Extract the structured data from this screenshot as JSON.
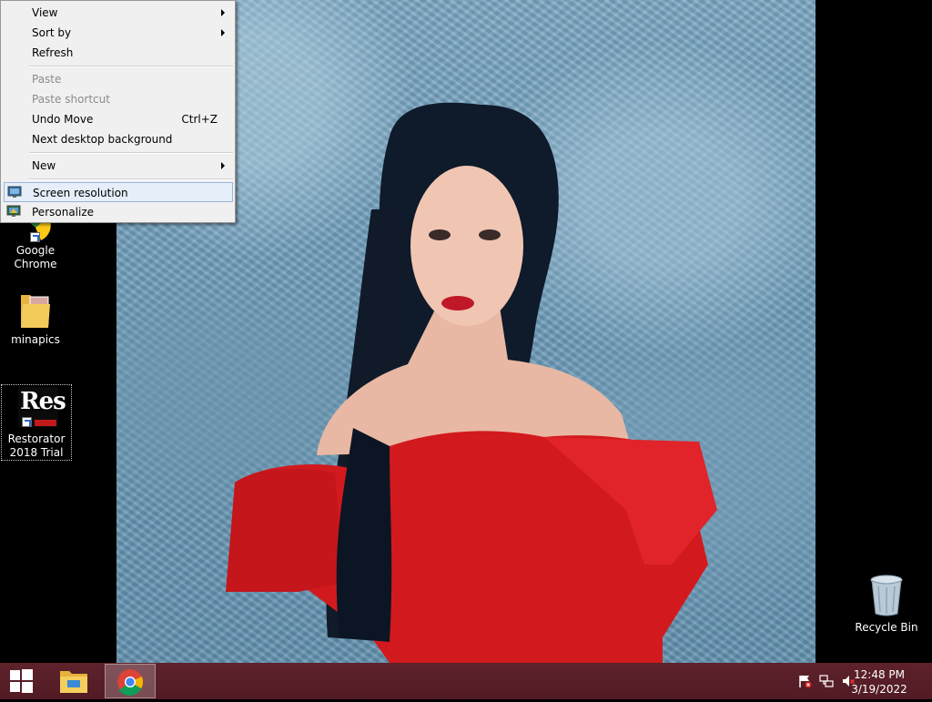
{
  "context_menu": {
    "items": [
      {
        "label": "View"
      },
      {
        "label": "Sort by"
      },
      {
        "label": "Refresh"
      },
      {
        "label": "Paste"
      },
      {
        "label": "Paste shortcut"
      },
      {
        "label": "Undo Move",
        "shortcut": "Ctrl+Z"
      },
      {
        "label": "Next desktop background"
      },
      {
        "label": "New"
      },
      {
        "label": "Screen resolution"
      },
      {
        "label": "Personalize"
      }
    ]
  },
  "desktop": {
    "icons": [
      {
        "label_line1": "Google",
        "label_line2": "Chrome",
        "icon": "google-chrome-icon"
      },
      {
        "label_line1": "minapics",
        "icon": "folder-icon"
      },
      {
        "label_line1": "Restorator",
        "label_line2": "2018 Trial",
        "icon": "restorator-icon",
        "logo_text": "Res"
      },
      {
        "label_line1": "Recycle Bin",
        "icon": "recycle-bin-icon"
      }
    ]
  },
  "taskbar": {
    "start_icon": "windows-logo-icon",
    "pinned": [
      {
        "icon": "file-explorer-icon"
      },
      {
        "icon": "google-chrome-icon"
      }
    ],
    "tray_icons": [
      "action-center-flag-icon",
      "network-icon",
      "volume-muted-icon"
    ],
    "clock": {
      "time": "12:48 PM",
      "date": "3/19/2022"
    }
  },
  "colors": {
    "menu_highlight": "#e5eef9",
    "menu_highlight_border": "#9ab7e0",
    "taskbar": "#6e2832"
  }
}
